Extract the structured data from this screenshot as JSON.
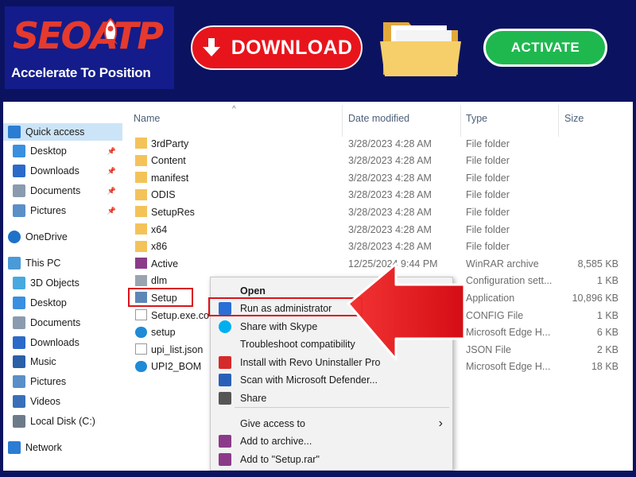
{
  "banner": {
    "logo_text": "SEOATP",
    "tagline": "Accelerate To Position",
    "download_label": "DOWNLOAD",
    "activate_label": "ACTIVATE",
    "colors": {
      "background": "#0b1360",
      "logo_bg": "#131c8a",
      "download": "#e8141c",
      "activate": "#1fb84f"
    }
  },
  "nav": {
    "items": [
      {
        "label": "Quick access",
        "icon": "star-icon",
        "pinned": false
      },
      {
        "label": "Desktop",
        "icon": "desktop-icon",
        "pinned": true
      },
      {
        "label": "Downloads",
        "icon": "download-arrow-icon",
        "pinned": true
      },
      {
        "label": "Documents",
        "icon": "document-icon",
        "pinned": true
      },
      {
        "label": "Pictures",
        "icon": "pictures-icon",
        "pinned": true
      },
      {
        "label": "OneDrive",
        "icon": "cloud-icon",
        "pinned": false
      },
      {
        "label": "This PC",
        "icon": "computer-icon",
        "pinned": false
      },
      {
        "label": "3D Objects",
        "icon": "cube-icon",
        "pinned": false
      },
      {
        "label": "Desktop",
        "icon": "desktop-icon",
        "pinned": false
      },
      {
        "label": "Documents",
        "icon": "document-icon",
        "pinned": false
      },
      {
        "label": "Downloads",
        "icon": "download-arrow-icon",
        "pinned": false
      },
      {
        "label": "Music",
        "icon": "music-icon",
        "pinned": false
      },
      {
        "label": "Pictures",
        "icon": "pictures-icon",
        "pinned": false
      },
      {
        "label": "Videos",
        "icon": "video-icon",
        "pinned": false
      },
      {
        "label": "Local Disk (C:)",
        "icon": "drive-icon",
        "pinned": false
      },
      {
        "label": "Network",
        "icon": "network-icon",
        "pinned": false
      }
    ]
  },
  "columns": {
    "name": "Name",
    "date": "Date modified",
    "type": "Type",
    "size": "Size"
  },
  "files": [
    {
      "name": "3rdParty",
      "date": "3/28/2023 4:28 AM",
      "type": "File folder",
      "size": "",
      "icon": "folder-icon"
    },
    {
      "name": "Content",
      "date": "3/28/2023 4:28 AM",
      "type": "File folder",
      "size": "",
      "icon": "folder-icon"
    },
    {
      "name": "manifest",
      "date": "3/28/2023 4:28 AM",
      "type": "File folder",
      "size": "",
      "icon": "folder-icon"
    },
    {
      "name": "ODIS",
      "date": "3/28/2023 4:28 AM",
      "type": "File folder",
      "size": "",
      "icon": "folder-icon"
    },
    {
      "name": "SetupRes",
      "date": "3/28/2023 4:28 AM",
      "type": "File folder",
      "size": "",
      "icon": "folder-icon"
    },
    {
      "name": "x64",
      "date": "3/28/2023 4:28 AM",
      "type": "File folder",
      "size": "",
      "icon": "folder-icon"
    },
    {
      "name": "x86",
      "date": "3/28/2023 4:28 AM",
      "type": "File folder",
      "size": "",
      "icon": "folder-icon"
    },
    {
      "name": "Active",
      "date": "12/25/2024 9:44 PM",
      "type": "WinRAR archive",
      "size": "8,585 KB",
      "icon": "winrar-icon"
    },
    {
      "name": "dlm",
      "date": "",
      "type": "Configuration sett...",
      "size": "1 KB",
      "icon": "config-file-icon"
    },
    {
      "name": "Setup",
      "date": "",
      "type": "Application",
      "size": "10,896 KB",
      "icon": "setup-app-icon"
    },
    {
      "name": "Setup.exe.co",
      "date": "",
      "type": "CONFIG File",
      "size": "1 KB",
      "icon": "blank-file-icon"
    },
    {
      "name": "setup",
      "date": "",
      "type": "Microsoft Edge H...",
      "size": "6 KB",
      "icon": "edge-icon"
    },
    {
      "name": "upi_list.json",
      "date": "",
      "type": "JSON File",
      "size": "2 KB",
      "icon": "blank-file-icon"
    },
    {
      "name": "UPI2_BOM",
      "date": "",
      "type": "Microsoft Edge H...",
      "size": "18 KB",
      "icon": "edge-icon"
    }
  ],
  "context_menu": {
    "items": [
      {
        "label": "Open",
        "icon": "",
        "bold": true
      },
      {
        "label": "Run as administrator",
        "icon": "uac-shield-icon",
        "bold": false
      },
      {
        "label": "Share with Skype",
        "icon": "skype-icon",
        "bold": false
      },
      {
        "label": "Troubleshoot compatibility",
        "icon": "",
        "bold": false
      },
      {
        "label": "Install with Revo Uninstaller Pro",
        "icon": "revo-icon",
        "bold": false
      },
      {
        "label": "Scan with Microsoft Defender...",
        "icon": "defender-icon",
        "bold": false
      },
      {
        "label": "Share",
        "icon": "share-icon",
        "bold": false
      },
      {
        "label": "Give access to",
        "icon": "",
        "bold": false,
        "submenu": true
      },
      {
        "label": "Add to archive...",
        "icon": "winrar-icon",
        "bold": false
      },
      {
        "label": "Add to \"Setup.rar\"",
        "icon": "winrar-icon",
        "bold": false
      }
    ]
  }
}
